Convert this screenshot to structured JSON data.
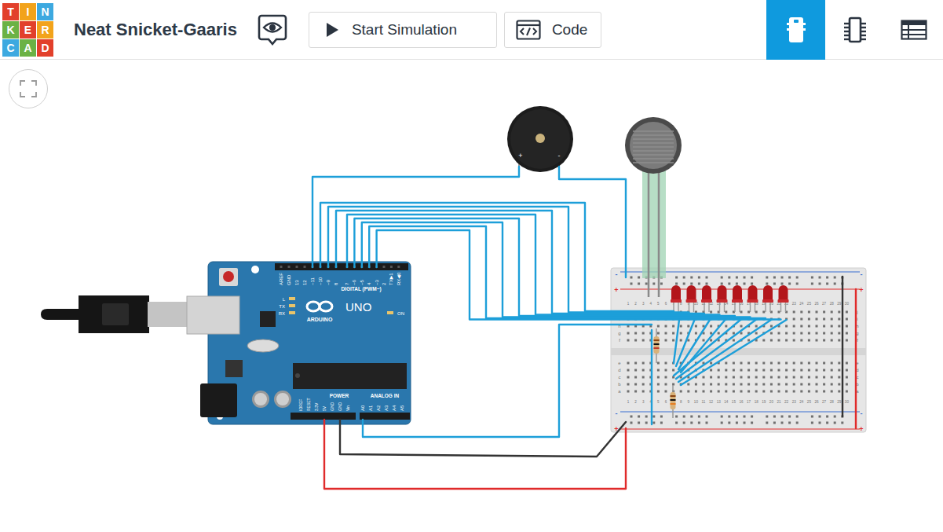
{
  "app": {
    "logo": [
      "T",
      "I",
      "N",
      "K",
      "E",
      "R",
      "C",
      "A",
      "D"
    ],
    "title": "Neat Snicket-Gaaris"
  },
  "toolbar": {
    "buttons": [
      {
        "label": "Start Simulation",
        "kind": "play"
      },
      {
        "label": "Code",
        "kind": "code"
      }
    ]
  },
  "view_tabs": [
    {
      "kind": "circuit",
      "selected": true
    },
    {
      "kind": "components",
      "selected": false
    },
    {
      "kind": "list",
      "selected": false
    }
  ],
  "arduino": {
    "brand": "ARDUINO",
    "model": "UNO",
    "power_led": "ON",
    "status_leds": [
      "L",
      "TX",
      "RX"
    ],
    "digital_title": "DIGITAL (PWM~)",
    "digital_pins": [
      "AREF",
      "GND",
      "13",
      "12",
      "~11",
      "~10",
      "~9",
      "8",
      "7",
      "~6",
      "~5",
      "4",
      "~3",
      "2",
      "TX▶1",
      "RX◀0"
    ],
    "power_title": "POWER",
    "power_pins": [
      "IOREF",
      "RESET",
      "3.3V",
      "5V",
      "GND",
      "GND",
      "Vin"
    ],
    "analog_title": "ANALOG IN",
    "analog_pins": [
      "A0",
      "A1",
      "A2",
      "A3",
      "A4",
      "A5"
    ]
  },
  "buzzer": {
    "pins": [
      "+",
      "-"
    ]
  },
  "leds": [
    {
      "on": false
    },
    {
      "on": false
    },
    {
      "on": false
    },
    {
      "on": false
    },
    {
      "on": false
    },
    {
      "on": false
    },
    {
      "on": false
    },
    {
      "on": false
    }
  ],
  "breadboard": {
    "rails": [
      {
        "mark": "-",
        "color": "#3a6fd0"
      },
      {
        "mark": "+",
        "color": "#e02b2b"
      }
    ],
    "columns": [
      "1",
      "2",
      "3",
      "4",
      "5",
      "6",
      "7",
      "8",
      "9",
      "10",
      "11",
      "12",
      "13",
      "14",
      "15",
      "16",
      "17",
      "18",
      "19",
      "20",
      "21",
      "22",
      "23",
      "24",
      "25",
      "26",
      "27",
      "28",
      "29",
      "30"
    ],
    "rows": [
      "a",
      "b",
      "c",
      "d",
      "e",
      "f",
      "g",
      "h",
      "i",
      "j"
    ]
  },
  "wires": [
    {
      "color": "#1d9fd9"
    },
    {
      "color": "#1d9fd9"
    },
    {
      "color": "#1d9fd9"
    },
    {
      "color": "#1d9fd9"
    },
    {
      "color": "#1d9fd9"
    },
    {
      "color": "#1d9fd9"
    },
    {
      "color": "#1d9fd9"
    },
    {
      "color": "#1d9fd9"
    },
    {
      "color": "#1d9fd9"
    },
    {
      "color": "#1d9fd9"
    },
    {
      "color": "#1d9fd9"
    },
    {
      "color": "#333333"
    },
    {
      "color": "#e02b2b"
    },
    {
      "color": "#1d9fd9"
    },
    {
      "color": "#1d9fd9"
    },
    {
      "color": "#1d9fd9"
    },
    {
      "color": "#1d9fd9"
    },
    {
      "color": "#1d9fd9"
    },
    {
      "color": "#1d9fd9"
    },
    {
      "color": "#1d9fd9"
    },
    {
      "color": "#1d9fd9"
    },
    {
      "color": "#1d9fd9"
    },
    {
      "color": "#333333"
    },
    {
      "color": "#e02b2b"
    }
  ]
}
